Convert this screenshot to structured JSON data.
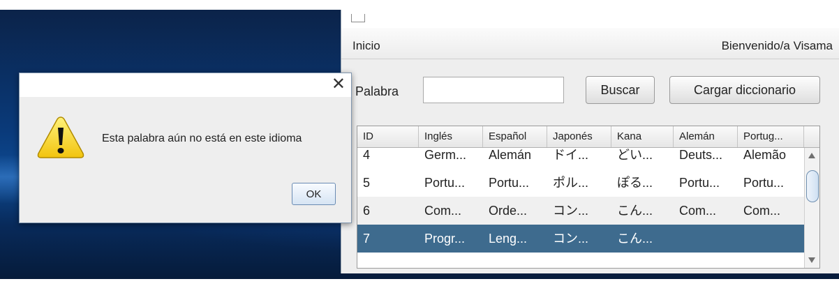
{
  "window": {
    "menu": {
      "inicio": "Inicio"
    },
    "welcome": "Bienvenido/a Visama",
    "search": {
      "label": "Palabra",
      "value": "",
      "buscar_label": "Buscar",
      "cargar_label": "Cargar diccionario"
    },
    "table": {
      "columns": [
        "ID",
        "Inglés",
        "Español",
        "Japonés",
        "Kana",
        "Alemán",
        "Portug..."
      ],
      "rows": [
        [
          "4",
          "Germ...",
          "Alemán",
          "ドイ...",
          "どい...",
          "Deuts...",
          "Alemão"
        ],
        [
          "5",
          "Portu...",
          "Portu...",
          "ポル...",
          "ぽる...",
          "Portu...",
          "Portu..."
        ],
        [
          "6",
          "Com...",
          "Orde...",
          "コン...",
          "こん...",
          "Com...",
          "Com..."
        ],
        [
          "7",
          "Progr...",
          "Leng...",
          "コン...",
          "こん...",
          "",
          ""
        ]
      ],
      "selected_row_id": "7"
    }
  },
  "dialog": {
    "message": "Esta palabra aún no está en este idioma",
    "ok_label": "OK",
    "icon": "warning-icon",
    "close_icon": "close-icon"
  },
  "colors": {
    "selected_row": "#3e6b8e",
    "warning_yellow": "#f7d51d",
    "desktop_blue": "#0a3a7a"
  }
}
